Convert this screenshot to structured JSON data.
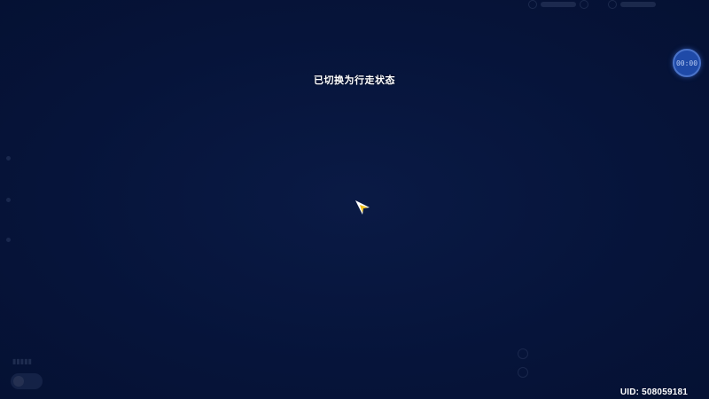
{
  "toast": {
    "message": "已切换为行走状态"
  },
  "timer": {
    "label": "00:00"
  },
  "uid": {
    "text": "UID: 508059181"
  },
  "icons": {
    "player": "player-arrow-icon",
    "timer": "timer-icon"
  },
  "colors": {
    "background": "#06143a",
    "timer_fill": "#1f4aa8",
    "marker_yellow": "#f3c21a"
  }
}
